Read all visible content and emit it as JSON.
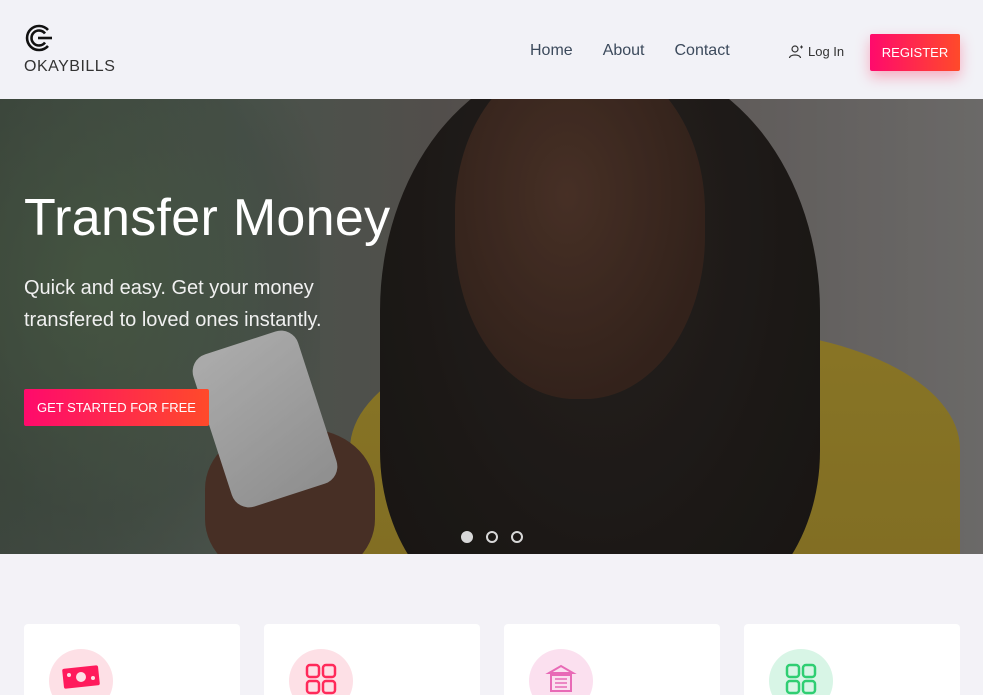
{
  "brand": {
    "name": "OKAYBILLS"
  },
  "nav": {
    "items": [
      "Home",
      "About",
      "Contact"
    ]
  },
  "auth": {
    "login_label": "Log In",
    "register_label": "REGISTER"
  },
  "hero": {
    "title": "Transfer Money",
    "subtitle": "Quick and easy. Get your money transfered to loved ones instantly.",
    "cta_label": "GET STARTED FOR FREE",
    "slides": 3,
    "active_slide": 1
  },
  "colors": {
    "accent_start": "#ff0a6c",
    "accent_end": "#ff4a2a",
    "nav_text": "#3c4a5c"
  },
  "feature_cards": [
    {
      "icon": "cash-icon",
      "bg": "#fde0e6",
      "color": "#ff1a5c"
    },
    {
      "icon": "grid-icon",
      "bg": "#fde0e6",
      "color": "#ff2a5a"
    },
    {
      "icon": "building-icon",
      "bg": "#fbe0ef",
      "color": "#e86ab6"
    },
    {
      "icon": "grid-icon",
      "bg": "#d8f5e6",
      "color": "#2fce72"
    }
  ]
}
